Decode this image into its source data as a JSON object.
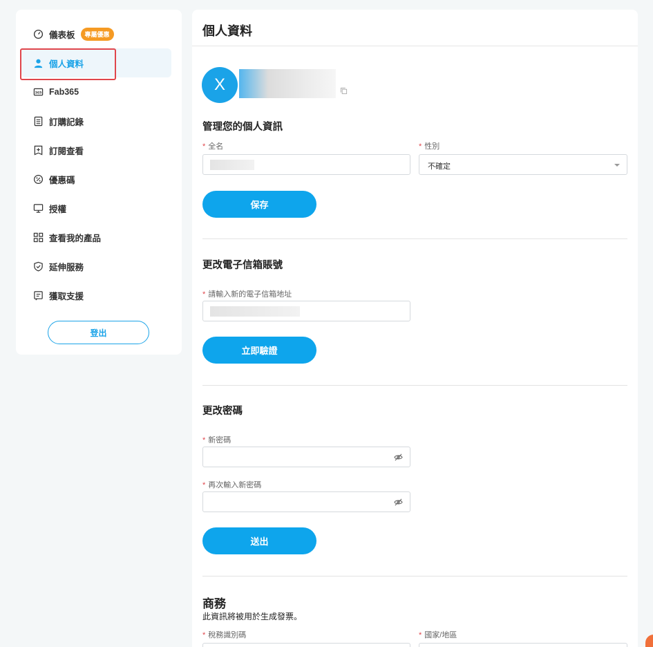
{
  "sidebar": {
    "items": [
      {
        "label": "儀表板",
        "icon": "gauge-icon",
        "badge": "專屬優惠"
      },
      {
        "label": "個人資料",
        "icon": "user-icon",
        "active": true
      },
      {
        "label": "Fab365",
        "icon": "fab365-icon"
      },
      {
        "label": "訂購記錄",
        "icon": "order-list-icon"
      },
      {
        "label": "訂閱查看",
        "icon": "subscription-icon"
      },
      {
        "label": "優惠碼",
        "icon": "coupon-icon"
      },
      {
        "label": "授權",
        "icon": "monitor-icon"
      },
      {
        "label": "查看我的產品",
        "icon": "grid-icon"
      },
      {
        "label": "延伸服務",
        "icon": "shield-icon"
      },
      {
        "label": "獲取支援",
        "icon": "support-icon"
      }
    ],
    "logout_label": "登出"
  },
  "main": {
    "title": "個人資料",
    "avatar_letter": "X",
    "profile": {
      "section_title": "管理您的個人資訊",
      "fullname_label": "全名",
      "gender_label": "性別",
      "gender_value": "不確定",
      "save_label": "保存"
    },
    "email": {
      "section_title": "更改電子信箱賬號",
      "new_email_label": "請輸入新的電子信箱地址",
      "verify_label": "立即驗證"
    },
    "password": {
      "section_title": "更改密碼",
      "new_password_label": "新密碼",
      "confirm_password_label": "再次輸入新密碼",
      "submit_label": "送出"
    },
    "business": {
      "section_title": "商務",
      "subtitle": "此資訊將被用於生成發票。",
      "tax_id_label": "稅務識別碼",
      "country_label": "國家/地區"
    }
  },
  "colors": {
    "accent": "#0ea5ec",
    "badge": "#f59a23",
    "required": "#e0454b"
  }
}
